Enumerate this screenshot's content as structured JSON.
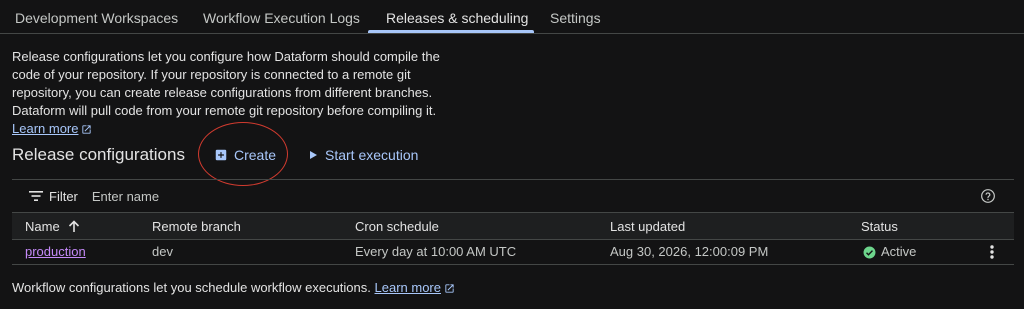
{
  "tabs": [
    {
      "label": "Development Workspaces"
    },
    {
      "label": "Workflow Execution Logs"
    },
    {
      "label": "Releases & scheduling",
      "active": true
    },
    {
      "label": "Settings"
    }
  ],
  "intro": {
    "text": "Release configurations let you configure how Dataform should compile the code of your repository. If your repository is connected to a remote git repository, you can create release configurations from different branches. Dataform will pull code from your remote git repository before compiling it.",
    "link_label": "Learn more"
  },
  "release_section": {
    "title": "Release configurations",
    "create_label": "Create",
    "start_execution_label": "Start execution"
  },
  "filter": {
    "label": "Filter",
    "placeholder": "Enter name"
  },
  "table": {
    "columns": [
      "Name",
      "Remote branch",
      "Cron schedule",
      "Last updated",
      "Status"
    ],
    "sorted_column": "Name",
    "sort_direction": "ascending",
    "rows": [
      {
        "name": "production",
        "remote_branch": "dev",
        "cron_schedule": "Every day at 10:00 AM UTC",
        "last_updated": "Aug 30, 2026, 12:00:09 PM",
        "status": "Active"
      }
    ]
  },
  "footer": {
    "text": "Workflow configurations let you schedule workflow executions.",
    "link_label": "Learn more"
  },
  "icons": {
    "create": "add-box-icon",
    "start_execution": "play-icon",
    "filter": "filter-lines-icon",
    "help": "help-circle-icon",
    "sort": "arrow-up-icon",
    "status": "check-circle-icon",
    "more": "more-vert-icon",
    "external": "open-in-new-icon"
  },
  "colors": {
    "background": "#131314",
    "accent": "#a8c7fa",
    "link_visited": "#c58af9",
    "success": "#6dd58c",
    "annotation": "#d13b2f"
  }
}
